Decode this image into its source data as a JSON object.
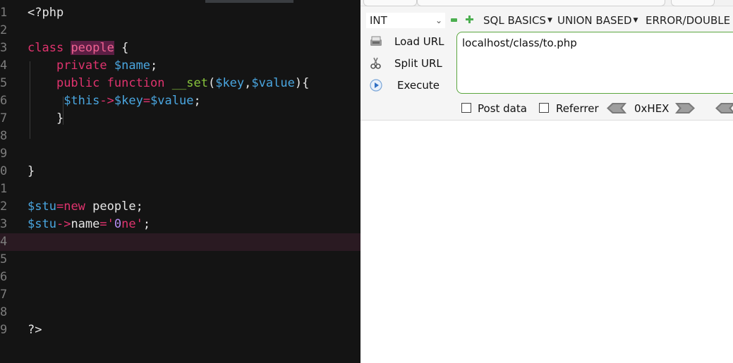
{
  "editor": {
    "lines": [
      {
        "n": "1",
        "tokens": [
          {
            "t": "<?php",
            "c": "plain"
          }
        ]
      },
      {
        "n": "2",
        "tokens": []
      },
      {
        "n": "3",
        "tokens": [
          {
            "t": "class",
            "c": "kw"
          },
          {
            "t": " ",
            "c": "plain"
          },
          {
            "t": "people",
            "c": "cls"
          },
          {
            "t": " {",
            "c": "plain"
          }
        ]
      },
      {
        "n": "4",
        "tokens": [
          {
            "t": "    ",
            "c": "plain"
          },
          {
            "t": "private",
            "c": "kw"
          },
          {
            "t": " ",
            "c": "plain"
          },
          {
            "t": "$name",
            "c": "var"
          },
          {
            "t": ";",
            "c": "plain"
          }
        ]
      },
      {
        "n": "5",
        "tokens": [
          {
            "t": "    ",
            "c": "plain"
          },
          {
            "t": "public",
            "c": "kw"
          },
          {
            "t": " ",
            "c": "plain"
          },
          {
            "t": "function",
            "c": "kw"
          },
          {
            "t": " ",
            "c": "plain"
          },
          {
            "t": "__set",
            "c": "fn"
          },
          {
            "t": "(",
            "c": "plain"
          },
          {
            "t": "$key",
            "c": "var"
          },
          {
            "t": ",",
            "c": "plain"
          },
          {
            "t": "$value",
            "c": "var"
          },
          {
            "t": "){",
            "c": "plain"
          }
        ]
      },
      {
        "n": "6",
        "tokens": [
          {
            "t": "     ",
            "c": "plain"
          },
          {
            "t": "$this",
            "c": "var"
          },
          {
            "t": "->",
            "c": "op"
          },
          {
            "t": "$key",
            "c": "var"
          },
          {
            "t": "=",
            "c": "op"
          },
          {
            "t": "$value",
            "c": "var"
          },
          {
            "t": ";",
            "c": "plain"
          }
        ]
      },
      {
        "n": "7",
        "tokens": [
          {
            "t": "    }",
            "c": "plain"
          }
        ]
      },
      {
        "n": "8",
        "tokens": []
      },
      {
        "n": "9",
        "tokens": []
      },
      {
        "n": "0",
        "tokens": [
          {
            "t": "}",
            "c": "plain"
          }
        ]
      },
      {
        "n": "1",
        "tokens": []
      },
      {
        "n": "2",
        "tokens": [
          {
            "t": "$stu",
            "c": "var"
          },
          {
            "t": "=",
            "c": "op"
          },
          {
            "t": "new",
            "c": "kw"
          },
          {
            "t": " people;",
            "c": "plain"
          }
        ]
      },
      {
        "n": "3",
        "tokens": [
          {
            "t": "$stu",
            "c": "var"
          },
          {
            "t": "->",
            "c": "op"
          },
          {
            "t": "name",
            "c": "plain"
          },
          {
            "t": "=",
            "c": "op"
          },
          {
            "t": "'",
            "c": "str"
          },
          {
            "t": "0",
            "c": "num"
          },
          {
            "t": "ne",
            "c": "str"
          },
          {
            "t": "'",
            "c": "str"
          },
          {
            "t": ";",
            "c": "plain"
          }
        ]
      },
      {
        "n": "4",
        "tokens": [],
        "current": true
      },
      {
        "n": "5",
        "tokens": []
      },
      {
        "n": "6",
        "tokens": []
      },
      {
        "n": "7",
        "tokens": []
      },
      {
        "n": "8",
        "tokens": []
      },
      {
        "n": "9",
        "tokens": [
          {
            "t": "?>",
            "c": "plain"
          }
        ]
      }
    ]
  },
  "hackbar": {
    "select_value": "INT",
    "menus": [
      {
        "label": "SQL BASICS"
      },
      {
        "label": "UNION BASED"
      },
      {
        "label": "ERROR/DOUBLE Q"
      }
    ],
    "load_url": "Load URL",
    "split_url": "Split URL",
    "execute": "Execute",
    "url_value": "localhost/class/to.php",
    "post_data": "Post data",
    "referrer": "Referrer",
    "hex_label": "0xHEX"
  },
  "colors": {
    "editor_bg": "#141414",
    "keyword": "#e0336e",
    "variable": "#4aa6e0",
    "function": "#87c43c",
    "url_border": "#5aa63e"
  }
}
